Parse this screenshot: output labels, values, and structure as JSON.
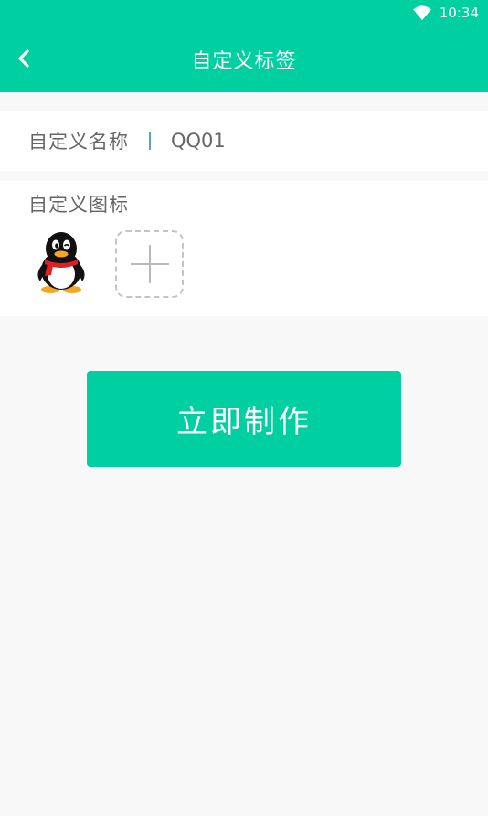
{
  "status_bar": {
    "time": "10:34",
    "wifi_icon": "wifi-icon"
  },
  "header": {
    "title": "自定义标签",
    "back_icon": "chevron-left-icon"
  },
  "name_field": {
    "label": "自定义名称",
    "value": "QQ01"
  },
  "icon_field": {
    "label": "自定义图标",
    "selected_icon": "qq-penguin-icon",
    "add_icon": "plus-icon"
  },
  "action": {
    "make_label": "立即制作"
  },
  "colors": {
    "accent": "#00cfa1",
    "background": "#f8f8f8",
    "text": "#666666"
  }
}
